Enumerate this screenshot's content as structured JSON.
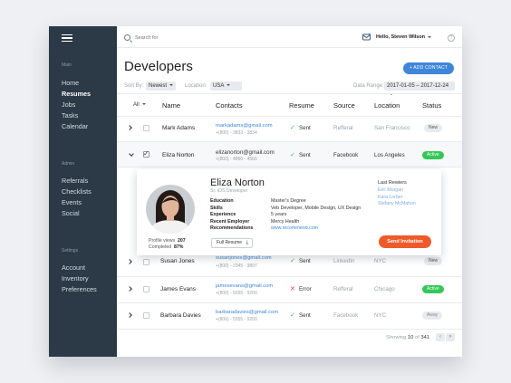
{
  "sidebar": {
    "sections": [
      {
        "title": "Main",
        "items": [
          "Home",
          "Resumes",
          "Jobs",
          "Tasks",
          "Calendar"
        ],
        "active": 1
      },
      {
        "title": "Admin",
        "items": [
          "Referrals",
          "Checklists",
          "Events",
          "Social"
        ],
        "active": -1
      },
      {
        "title": "Settings",
        "items": [
          "Account",
          "Inventory",
          "Preferences"
        ],
        "active": -1
      }
    ]
  },
  "header": {
    "search_placeholder": "Search for",
    "user_greeting": "Hello, Steven Wilson",
    "help": "?"
  },
  "page": {
    "title": "Developers",
    "add_button": "+ ADD CONTACT"
  },
  "filters": {
    "sort_label": "Sort By:",
    "sort_value": "Newest",
    "location_label": "Location:",
    "location_value": "USA",
    "date_label": "Data Range:",
    "date_value": "2017-01-05  –  2017-12-24"
  },
  "table": {
    "all_label": "All",
    "columns": [
      "Name",
      "Contacts",
      "Resume",
      "Source",
      "Location",
      "Status"
    ],
    "rows": [
      {
        "name": "Mark Adams",
        "email": "markadams@gmail.com",
        "phone": "+(800) - 3833 - 3834",
        "resume": "Sent",
        "source": "Refferal",
        "location": "San Francisco",
        "status": "New"
      },
      {
        "name": "Eliza Norton",
        "email": "elizanorton@gmail.com",
        "phone": "+(800) - 4860 - 4566",
        "resume": "Sent",
        "source": "Facebook",
        "location": "Los Angeles",
        "status": "Active"
      },
      {
        "name": "Susan Jones",
        "email": "susanjones@gmail.com",
        "phone": "+(800) - 2345 - 9897",
        "resume": "Sent",
        "source": "LinkedIn",
        "location": "NYC",
        "status": "New"
      },
      {
        "name": "James Evans",
        "email": "jamesevans@gmail.com",
        "phone": "+(800) - 5555 - 9200",
        "resume": "Error",
        "source": "Refferal",
        "location": "Chicago",
        "status": "Active"
      },
      {
        "name": "Barbara Davies",
        "email": "barbaradavies@gmail.com",
        "phone": "+(800) - 5555 - 9200",
        "resume": "Sent",
        "source": "Facebook",
        "location": "NYC",
        "status": "Away"
      }
    ]
  },
  "profile": {
    "name": "Eliza Norton",
    "role": "Sr. iOS Developer",
    "fields": [
      {
        "label": "Education",
        "value": "Master's Degree"
      },
      {
        "label": "Skills",
        "value": "Veb Developer, Mobile Design, UX Design"
      },
      {
        "label": "Experience",
        "value": "5 years"
      },
      {
        "label": "Recent Employer",
        "value": "Mercy Health"
      },
      {
        "label": "Recommendations",
        "value": "www.recommend.com"
      }
    ],
    "views_label": "Profile views",
    "views_value": "207",
    "completed_label": "Completed",
    "completed_value": "87%",
    "full_resume": "Full Resume",
    "last_reviews_title": "Last Rewiers",
    "reviewers": [
      "Eric Morgan",
      "Kara Lorber",
      "Stefany McMahon"
    ],
    "send_button": "Send Invitation"
  },
  "pagination": {
    "showing": "Showing",
    "count": "10",
    "of": "of",
    "total": "341"
  },
  "colors": {
    "sidebar": "#2b3a46",
    "accent": "#3f86d9",
    "active_green": "#35c759",
    "send_orange": "#ef5a2a",
    "error_red": "#e64b3b"
  },
  "icons": [
    "menu-icon",
    "search-icon",
    "mail-icon",
    "help-icon",
    "chevron-right-icon",
    "chevron-down-icon",
    "check-icon",
    "x-icon",
    "download-icon",
    "calendar-caret-icon"
  ]
}
